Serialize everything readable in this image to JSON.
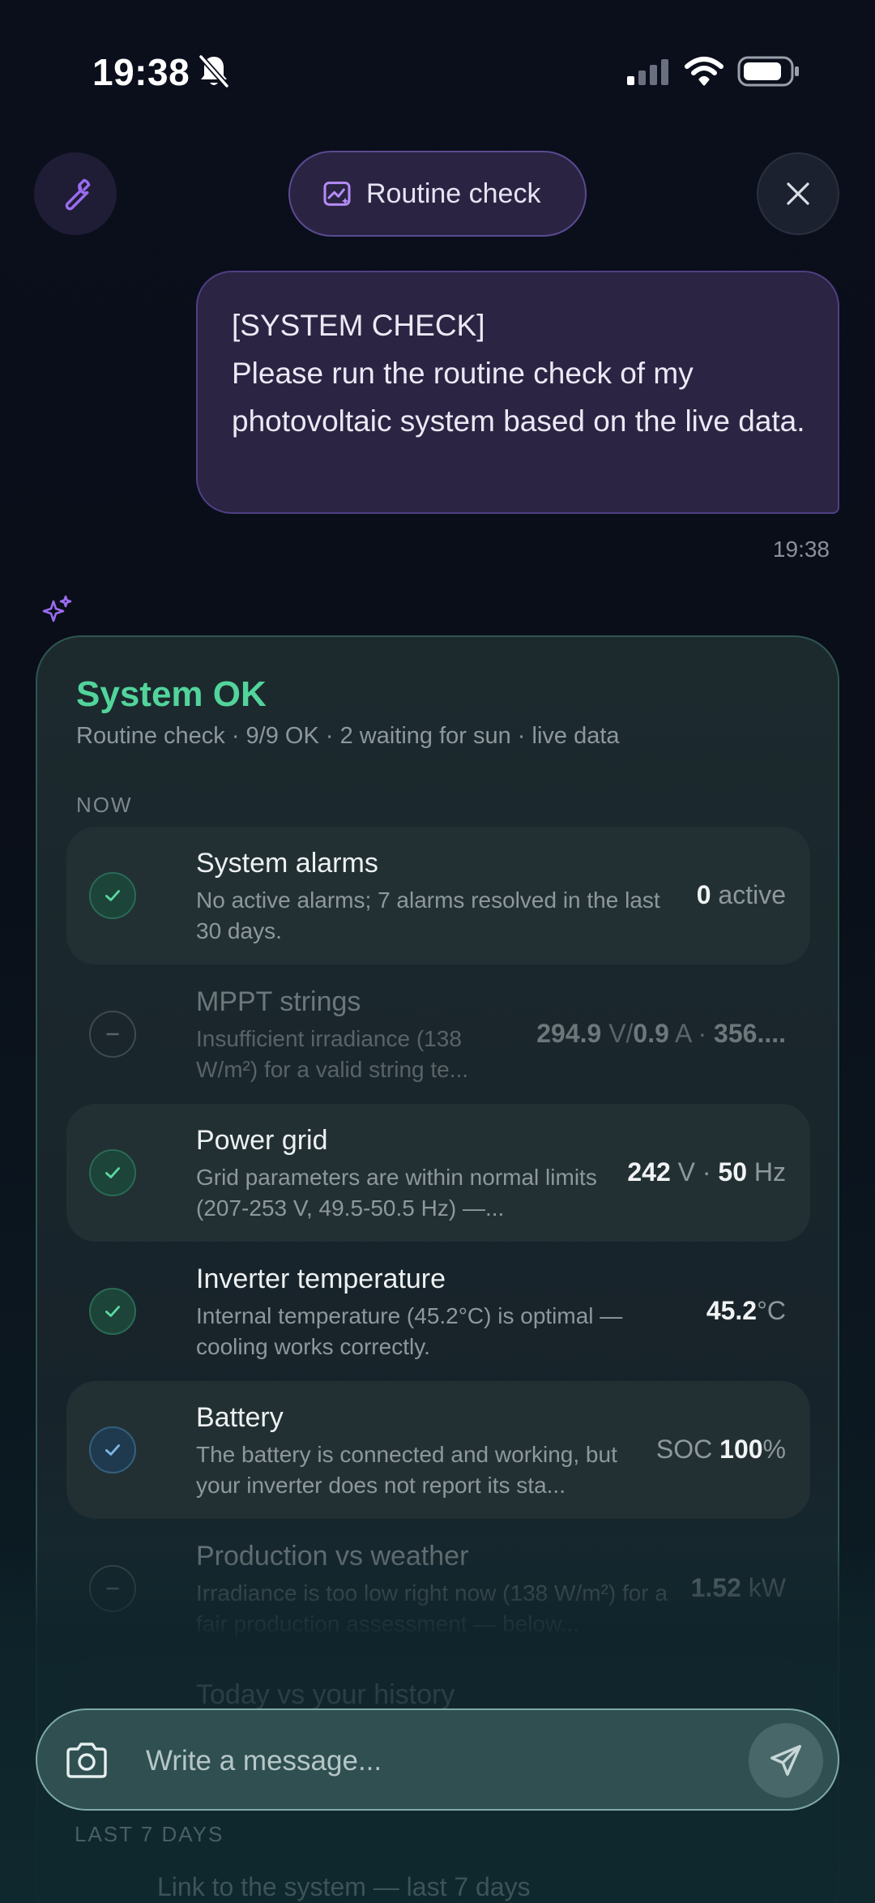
{
  "status_bar": {
    "time": "19:38"
  },
  "header": {
    "mode_label": "Routine check"
  },
  "user_message": {
    "text": "[SYSTEM CHECK]\nPlease run the routine check of my photovoltaic system based on the live data.",
    "time": "19:38"
  },
  "card": {
    "title": "System OK",
    "subtitle": "Routine check  ·  9/9 OK · 2 waiting for sun  ·  live data",
    "section_now": "NOW",
    "rows": [
      {
        "title": "System alarms",
        "desc": "No active alarms; 7 alarms resolved in the last 30 days.",
        "value_main": "0",
        "value_unit": " active",
        "state": "ok"
      },
      {
        "title": "MPPT strings",
        "desc": "Insufficient irradiance (138 W/m²) for a valid string te...",
        "value_a": "294.9",
        "value_a_unit": " V/",
        "value_b": "0.9",
        "value_b_unit": " A · ",
        "value_c": "356....",
        "state": "wait"
      },
      {
        "title": "Power grid",
        "desc": "Grid parameters are within normal limits (207-253 V, 49.5-50.5 Hz) —...",
        "value_a": "242",
        "value_a_unit": " V · ",
        "value_b": "50",
        "value_b_unit": " Hz",
        "state": "ok"
      },
      {
        "title": "Inverter temperature",
        "desc": "Internal temperature (45.2°C) is optimal — cooling works correctly.",
        "value_main": "45.2",
        "value_unit": "°C",
        "state": "ok"
      },
      {
        "title": "Battery",
        "desc": "The battery is connected and working, but your inverter does not report its sta...",
        "value_prefix": "SOC ",
        "value_main": "100",
        "value_unit": "%",
        "state": "info"
      },
      {
        "title": "Production vs weather",
        "desc": "Irradiance is too low right now (138 W/m²) for a fair production assessment — below...",
        "value_main": "1.52",
        "value_unit": " kW",
        "state": "wait"
      },
      {
        "title": "Today vs your history"
      }
    ],
    "section_last7": "LAST 7 DAYS",
    "last7_line": "Link to the system — last 7 days"
  },
  "composer": {
    "placeholder": "Write a message..."
  },
  "colors": {
    "accent_green": "#52d49b",
    "accent_purple": "#9b6cf0"
  }
}
